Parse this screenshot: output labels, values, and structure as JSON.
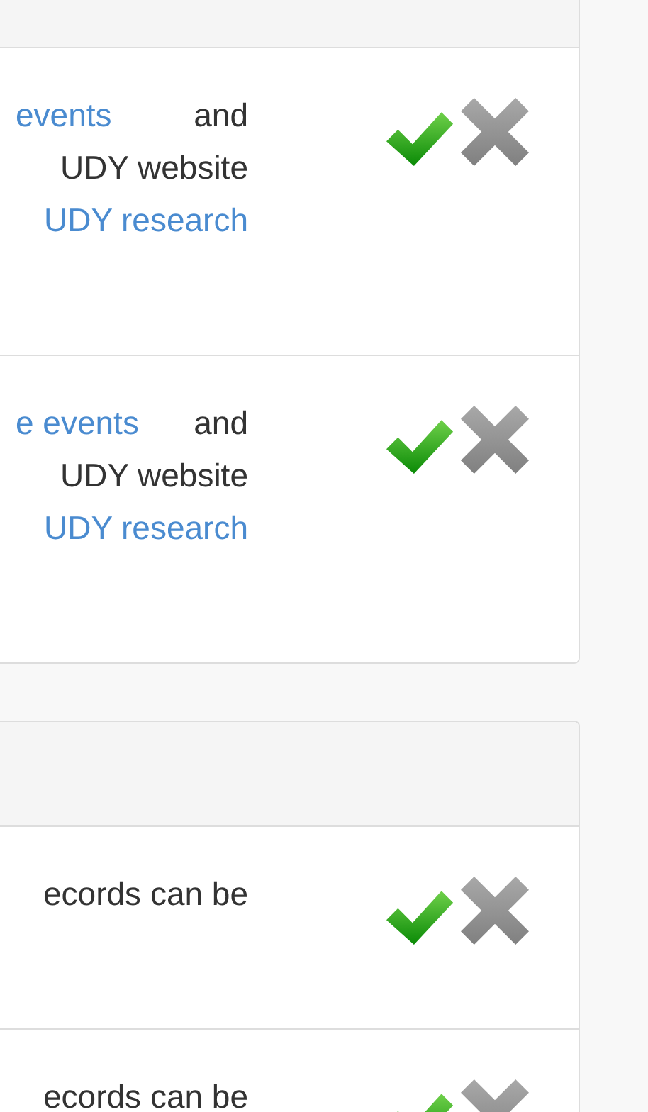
{
  "panels": [
    {
      "rows": [
        {
          "lines": [
            [
              {
                "text": "events",
                "kind": "link"
              },
              {
                "text": "and",
                "kind": "plain"
              }
            ],
            [
              {
                "text": "UDY website",
                "kind": "plain"
              }
            ],
            [
              {
                "text": "UDY research",
                "kind": "link"
              }
            ]
          ]
        },
        {
          "lines": [
            [
              {
                "text": "e events",
                "kind": "link"
              },
              {
                "text": "and",
                "kind": "plain"
              }
            ],
            [
              {
                "text": "UDY website",
                "kind": "plain"
              }
            ],
            [
              {
                "text": "UDY research",
                "kind": "link"
              }
            ]
          ]
        }
      ]
    },
    {
      "rows": [
        {
          "lines": [
            [
              {
                "text": "ecords can be",
                "kind": "plain"
              }
            ]
          ]
        },
        {
          "lines": [
            [
              {
                "text": "ecords can be",
                "kind": "plain"
              }
            ]
          ]
        }
      ]
    }
  ]
}
